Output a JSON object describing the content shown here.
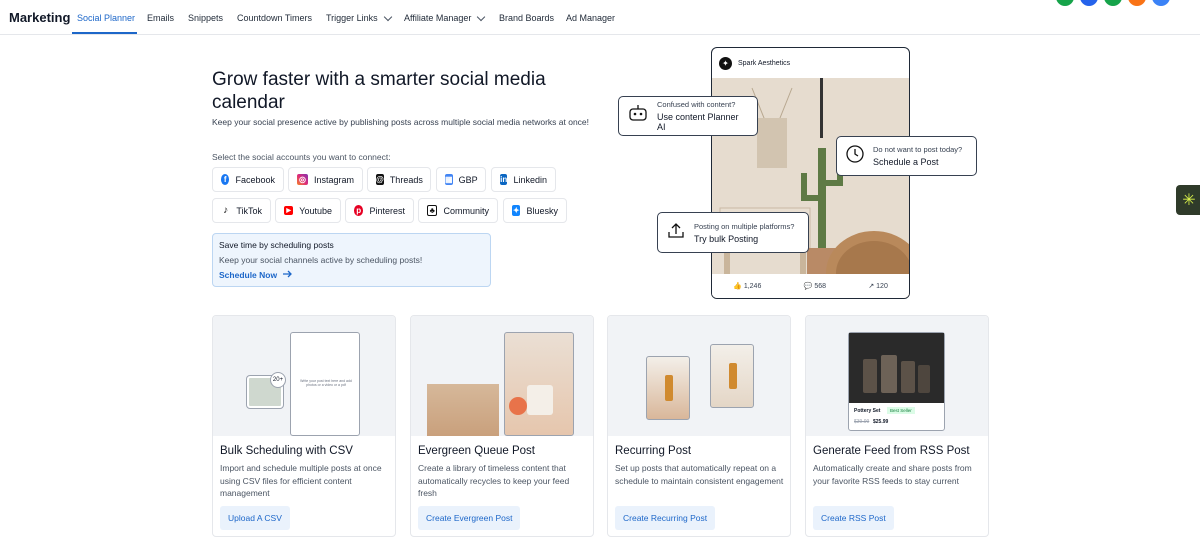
{
  "nav": {
    "brand": "Marketing",
    "items": [
      {
        "label": "Social Planner"
      },
      {
        "label": "Emails"
      },
      {
        "label": "Snippets"
      },
      {
        "label": "Countdown Timers"
      },
      {
        "label": "Trigger Links"
      },
      {
        "label": "Affiliate Manager"
      },
      {
        "label": "Brand Boards"
      },
      {
        "label": "Ad Manager"
      }
    ]
  },
  "hero": {
    "title": "Grow faster with a smarter social media calendar",
    "subtitle": "Keep your social presence active by publishing posts across multiple social media networks at once!",
    "select_label": "Select the social accounts you want to connect:"
  },
  "accounts": [
    {
      "label": "Facebook",
      "icon": "facebook-icon",
      "color": "#1877f2"
    },
    {
      "label": "Instagram",
      "icon": "instagram-icon",
      "color": "#d6249f"
    },
    {
      "label": "Threads",
      "icon": "threads-icon",
      "color": "#111111"
    },
    {
      "label": "GBP",
      "icon": "google-business-icon",
      "color": "#4285f4"
    },
    {
      "label": "Linkedin",
      "icon": "linkedin-icon",
      "color": "#0a66c2"
    },
    {
      "label": "TikTok",
      "icon": "tiktok-icon",
      "color": "#111111"
    },
    {
      "label": "Youtube",
      "icon": "youtube-icon",
      "color": "#ff0000"
    },
    {
      "label": "Pinterest",
      "icon": "pinterest-icon",
      "color": "#e60023"
    },
    {
      "label": "Community",
      "icon": "community-icon",
      "color": "#111111"
    },
    {
      "label": "Bluesky",
      "icon": "bluesky-icon",
      "color": "#1185fe"
    }
  ],
  "schedule_box": {
    "title": "Save time by scheduling posts",
    "desc": "Keep your social channels active by scheduling posts!",
    "link": "Schedule Now"
  },
  "phone": {
    "account": "Spark Aesthetics",
    "likes": "1,246",
    "comments": "568",
    "shares": "120"
  },
  "callouts": {
    "ai": {
      "question": "Confused with content?",
      "action": "Use content Planner AI"
    },
    "schedule": {
      "question": "Do not want to post today?",
      "action": "Schedule a Post"
    },
    "bulk": {
      "question": "Posting on multiple platforms?",
      "action": "Try bulk Posting"
    }
  },
  "cards": [
    {
      "title": "Bulk Scheduling with CSV",
      "desc": "Import and schedule multiple posts at once using CSV files for efficient content management",
      "button": "Upload A CSV"
    },
    {
      "title": "Evergreen Queue Post",
      "desc": "Create a library of timeless content that automatically recycles to keep your feed fresh",
      "button": "Create Evergreen Post"
    },
    {
      "title": "Recurring Post",
      "desc": "Set up posts that automatically repeat on a schedule to maintain consistent engagement",
      "button": "Create Recurring Post"
    },
    {
      "title": "Generate Feed from RSS Post",
      "desc": "Automatically create and share posts from your favorite RSS feeds to stay current",
      "button": "Create RSS Post"
    }
  ],
  "card_art": {
    "bulk_badge": "20+",
    "bulk_phone_text": "Write your post text here and add photos or a video or a pdf",
    "rss_product": "Pottery Set",
    "rss_badge": "Best Seller",
    "rss_old_price": "$39.99",
    "rss_price": "$25.99"
  },
  "colors": {
    "accent": "#1d67c9",
    "info_bg": "#eef5fd"
  }
}
